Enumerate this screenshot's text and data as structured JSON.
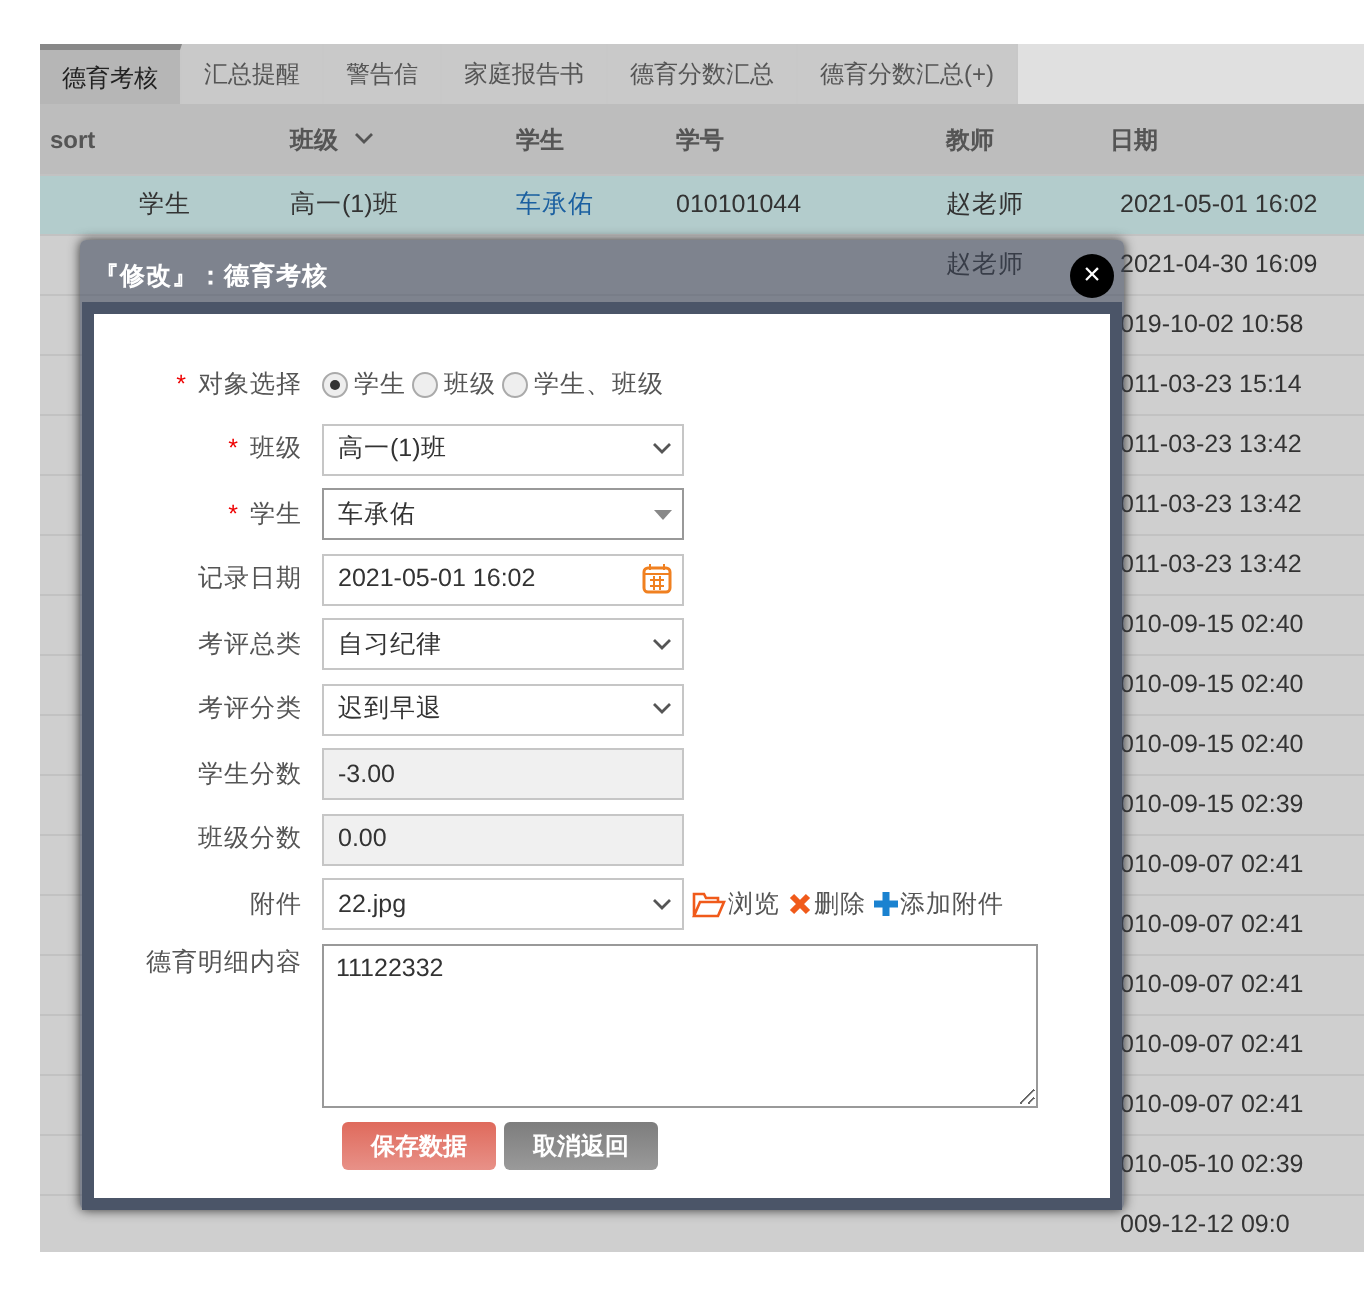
{
  "tabs": [
    {
      "label": "德育考核",
      "selected": true
    },
    {
      "label": "汇总提醒",
      "selected": false
    },
    {
      "label": "警告信",
      "selected": false
    },
    {
      "label": "家庭报告书",
      "selected": false
    },
    {
      "label": "德育分数汇总",
      "selected": false
    },
    {
      "label": "德育分数汇总(+)",
      "selected": false
    }
  ],
  "table": {
    "columns": [
      {
        "label": "sort",
        "sorted": false
      },
      {
        "label": "班级",
        "sorted": true
      },
      {
        "label": "学生",
        "sorted": false
      },
      {
        "label": "学号",
        "sorted": false
      },
      {
        "label": "教师",
        "sorted": false
      },
      {
        "label": "日期",
        "sorted": false
      }
    ],
    "rows": [
      {
        "selected": true,
        "cells": [
          "学生",
          "高一(1)班",
          "车承佑",
          "010101044",
          "赵老师",
          "2021-05-01 16:02"
        ]
      },
      {
        "selected": false,
        "cells": [
          "",
          "",
          "",
          "",
          "赵老师",
          "2021-04-30 16:09"
        ]
      },
      {
        "selected": false,
        "cells": [
          "",
          "",
          "",
          "",
          "",
          "019-10-02 10:58"
        ]
      },
      {
        "selected": false,
        "cells": [
          "",
          "",
          "",
          "",
          "",
          "011-03-23 15:14"
        ]
      },
      {
        "selected": false,
        "cells": [
          "",
          "",
          "",
          "",
          "",
          "011-03-23 13:42"
        ]
      },
      {
        "selected": false,
        "cells": [
          "",
          "",
          "",
          "",
          "",
          "011-03-23 13:42"
        ]
      },
      {
        "selected": false,
        "cells": [
          "",
          "",
          "",
          "",
          "",
          "011-03-23 13:42"
        ]
      },
      {
        "selected": false,
        "cells": [
          "",
          "",
          "",
          "",
          "",
          "010-09-15 02:40"
        ]
      },
      {
        "selected": false,
        "cells": [
          "",
          "",
          "",
          "",
          "",
          "010-09-15 02:40"
        ]
      },
      {
        "selected": false,
        "cells": [
          "",
          "",
          "",
          "",
          "",
          "010-09-15 02:40"
        ]
      },
      {
        "selected": false,
        "cells": [
          "",
          "",
          "",
          "",
          "",
          "010-09-15 02:39"
        ]
      },
      {
        "selected": false,
        "cells": [
          "",
          "",
          "",
          "",
          "",
          "010-09-07 02:41"
        ]
      },
      {
        "selected": false,
        "cells": [
          "",
          "",
          "",
          "",
          "",
          "010-09-07 02:41"
        ]
      },
      {
        "selected": false,
        "cells": [
          "",
          "",
          "",
          "",
          "",
          "010-09-07 02:41"
        ]
      },
      {
        "selected": false,
        "cells": [
          "",
          "",
          "",
          "",
          "",
          "010-09-07 02:41"
        ]
      },
      {
        "selected": false,
        "cells": [
          "",
          "",
          "",
          "",
          "",
          "010-09-07 02:41"
        ]
      },
      {
        "selected": false,
        "cells": [
          "",
          "",
          "",
          "",
          "",
          "010-05-10 02:39"
        ]
      },
      {
        "selected": false,
        "cells": [
          "",
          "",
          "",
          "",
          "",
          "009-12-12 09:0"
        ]
      }
    ]
  },
  "modal": {
    "title": "『修改』：德育考核",
    "close": "×",
    "fields": [
      {
        "kind": "radio",
        "label": "对象选择",
        "required_mark": "*",
        "options": [
          {
            "label": "学生",
            "selected": true
          },
          {
            "label": "班级",
            "selected": false
          },
          {
            "label": "学生、班级",
            "selected": false
          }
        ]
      },
      {
        "kind": "select",
        "label": "班级",
        "required_mark": "*",
        "value": "高一(1)班"
      },
      {
        "kind": "combo",
        "label": "学生",
        "required_mark": "*",
        "value": "车承佑"
      },
      {
        "kind": "date",
        "label": "记录日期",
        "value": "2021-05-01 16:02"
      },
      {
        "kind": "select",
        "label": "考评总类",
        "value": "自习纪律"
      },
      {
        "kind": "select",
        "label": "考评分类",
        "value": "迟到早退"
      },
      {
        "kind": "readonly",
        "label": "学生分数",
        "value": "-3.00"
      },
      {
        "kind": "readonly",
        "label": "班级分数",
        "value": "0.00"
      },
      {
        "kind": "file",
        "label": "附件",
        "value": "22.jpg",
        "actions": [
          {
            "kind": "browse",
            "label": "浏览"
          },
          {
            "kind": "delete",
            "label": "删除"
          },
          {
            "kind": "add",
            "label": "添加附件"
          }
        ]
      },
      {
        "kind": "textarea",
        "label": "德育明细内容",
        "value": "11122332"
      }
    ],
    "buttons": [
      {
        "kind": "primary",
        "label": "保存数据"
      },
      {
        "kind": "secondary",
        "label": "取消返回"
      }
    ]
  }
}
